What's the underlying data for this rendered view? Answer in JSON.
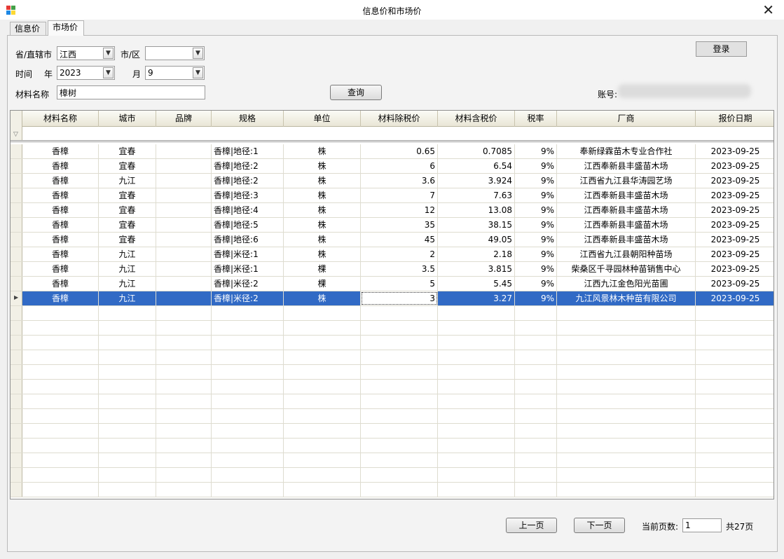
{
  "window": {
    "title": "信息价和市场价",
    "close_glyph": "✕"
  },
  "tabs": [
    {
      "label": "信息价",
      "active": false
    },
    {
      "label": "市场价",
      "active": true
    }
  ],
  "filters": {
    "province_label": "省/直辖市",
    "province_value": "江西",
    "city_label": "市/区",
    "city_value": "",
    "time_label": "时间",
    "year_label": "年",
    "year_value": "2023",
    "month_label": "月",
    "month_value": "9",
    "material_label": "材料名称",
    "material_value": "樟树",
    "query_button": "查询",
    "login_button": "登录",
    "account_label": "账号:"
  },
  "grid": {
    "columns": [
      "材料名称",
      "城市",
      "品牌",
      "规格",
      "单位",
      "材料除税价",
      "材料含税价",
      "税率",
      "厂商",
      "报价日期"
    ],
    "rows": [
      [
        "香樟",
        "宜春",
        "",
        "香樟|地径:1",
        "株",
        "0.65",
        "0.7085",
        "9%",
        "奉新绿霖苗木专业合作社",
        "2023-09-25"
      ],
      [
        "香樟",
        "宜春",
        "",
        "香樟|地径:2",
        "株",
        "6",
        "6.54",
        "9%",
        "江西奉新县丰盛苗木场",
        "2023-09-25"
      ],
      [
        "香樟",
        "九江",
        "",
        "香樟|地径:2",
        "株",
        "3.6",
        "3.924",
        "9%",
        "江西省九江县华涛园艺场",
        "2023-09-25"
      ],
      [
        "香樟",
        "宜春",
        "",
        "香樟|地径:3",
        "株",
        "7",
        "7.63",
        "9%",
        "江西奉新县丰盛苗木场",
        "2023-09-25"
      ],
      [
        "香樟",
        "宜春",
        "",
        "香樟|地径:4",
        "株",
        "12",
        "13.08",
        "9%",
        "江西奉新县丰盛苗木场",
        "2023-09-25"
      ],
      [
        "香樟",
        "宜春",
        "",
        "香樟|地径:5",
        "株",
        "35",
        "38.15",
        "9%",
        "江西奉新县丰盛苗木场",
        "2023-09-25"
      ],
      [
        "香樟",
        "宜春",
        "",
        "香樟|地径:6",
        "株",
        "45",
        "49.05",
        "9%",
        "江西奉新县丰盛苗木场",
        "2023-09-25"
      ],
      [
        "香樟",
        "九江",
        "",
        "香樟|米径:1",
        "株",
        "2",
        "2.18",
        "9%",
        "江西省九江县朝阳种苗场",
        "2023-09-25"
      ],
      [
        "香樟",
        "九江",
        "",
        "香樟|米径:1",
        "棵",
        "3.5",
        "3.815",
        "9%",
        "柴桑区千寻园林种苗销售中心",
        "2023-09-25"
      ],
      [
        "香樟",
        "九江",
        "",
        "香樟|米径:2",
        "棵",
        "5",
        "5.45",
        "9%",
        "江西九江金色阳光苗圃",
        "2023-09-25"
      ],
      [
        "香樟",
        "九江",
        "",
        "香樟|米径:2",
        "株",
        "3",
        "3.27",
        "9%",
        "九江风景林木种苗有限公司",
        "2023-09-25"
      ]
    ],
    "selected_row": 10
  },
  "pager": {
    "prev_button": "上一页",
    "next_button": "下一页",
    "current_label": "当前页数:",
    "current_value": "1",
    "total_text": "共27页"
  }
}
